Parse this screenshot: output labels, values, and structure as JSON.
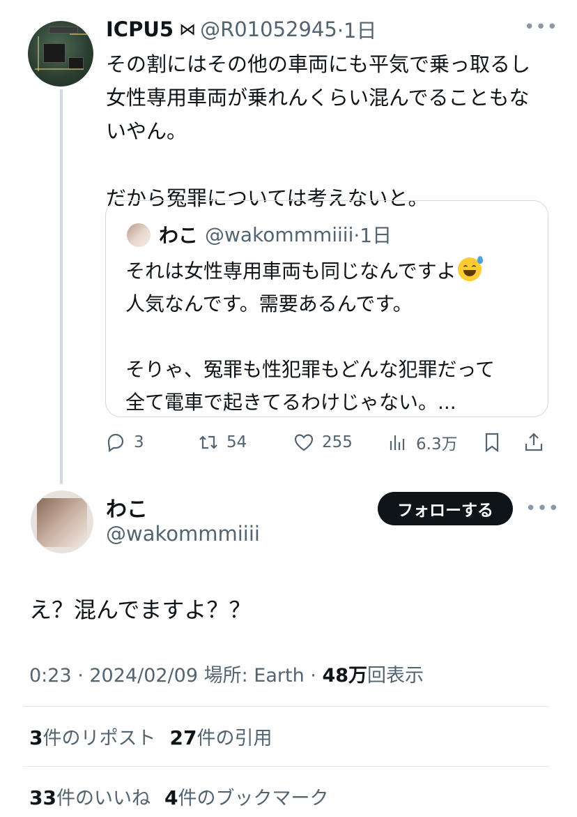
{
  "parent_tweet": {
    "display_name": "ICPU5",
    "badge": "⋈",
    "handle": "@R01052945",
    "time": "·1日",
    "more": "•••",
    "body": "その割にはその他の車両にも平気で乗っ取るし\n女性専用車両が乗れんくらい混んでることもな\nいやん。\n\nだから冤罪については考えないと。",
    "quote": {
      "display_name": "わこ",
      "handle": "@wakommmiiii",
      "time": "·1日",
      "line1": "それは女性専用車両も同じなんですよ",
      "emoji": "grinning-sweat-emoji",
      "body_rest": "人気なんです。需要あるんです。\n\nそりゃ、冤罪も性犯罪もどんな犯罪だって\n全て電車で起きてるわけじゃない。..."
    },
    "actions": {
      "replies": "3",
      "reposts": "54",
      "likes": "255",
      "views": "6.3万"
    }
  },
  "main_tweet": {
    "display_name": "わこ",
    "handle": "@wakommmiiii",
    "follow_label": "フォローする",
    "more": "•••",
    "text": "え？混んでますよ？？",
    "meta": {
      "time": "0:23 · 2024/02/09",
      "location": "場所: Earth ·",
      "views_count": "48万",
      "views_label": "回表示"
    },
    "stats": {
      "reposts_count": "3",
      "reposts_label": "件のリポスト",
      "quotes_count": "27",
      "quotes_label": "件の引用",
      "likes_count": "33",
      "likes_label": "件のいいね",
      "bookmarks_count": "4",
      "bookmarks_label": "件のブックマーク"
    }
  },
  "colors": {
    "text": "#0f1419",
    "muted": "#536471",
    "border": "#cfd9de",
    "follow_bg": "#0f1419"
  }
}
